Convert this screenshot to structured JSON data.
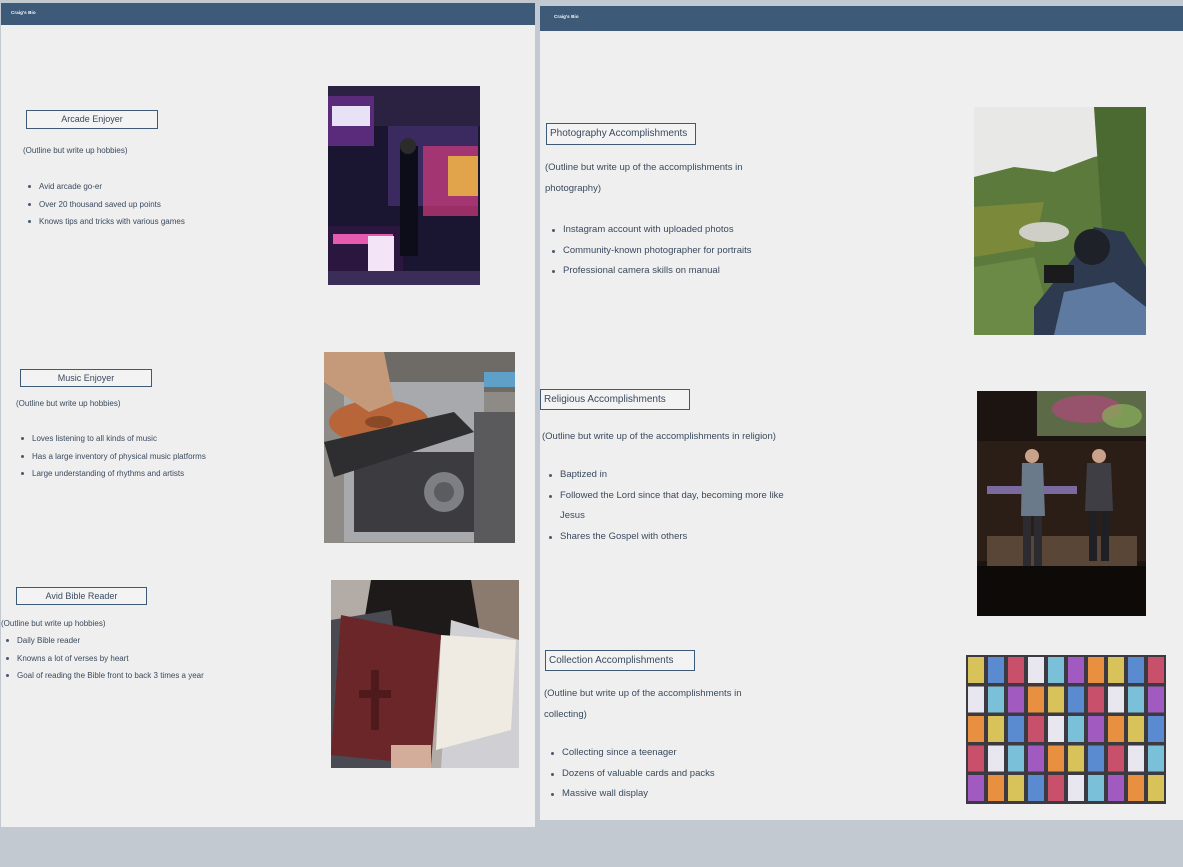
{
  "left": {
    "brand": "Craig's Bio",
    "hobbies": [
      {
        "title": "Arcade Enjoyer",
        "note": "(Outline but write up hobbies)",
        "items": [
          "Avid arcade go-er",
          "Over 20 thousand saved up points",
          "Knows tips and tricks with various games"
        ],
        "image": "arcade-photo"
      },
      {
        "title": "Music Enjoyer",
        "note": "(Outline but write up hobbies)",
        "items": [
          "Loves listening to all kinds of music",
          "Has a large inventory of physical music platforms",
          "Large understanding of rhythms and artists"
        ],
        "image": "cd-player-photo"
      },
      {
        "title": "Avid Bible Reader",
        "note": "(Outline but write up hobbies)",
        "items": [
          "Daily Bible reader",
          "Knowns a lot of verses by heart",
          "Goal of reading the Bible front to back 3 times a year"
        ],
        "image": "bible-reading-photo"
      }
    ]
  },
  "right": {
    "brand": "Craig's Bio",
    "sections": [
      {
        "title": "Photography Accomplishments",
        "note_lines": [
          "(Outline but write up of the accomplishments in",
          "photography)"
        ],
        "items": [
          [
            "Instagram account with uploaded photos"
          ],
          [
            "Community-known photographer for portraits"
          ],
          [
            "Professional camera skills on manual"
          ]
        ],
        "image": "garden-photographer-photo"
      },
      {
        "title": "Religious Accomplishments",
        "note_lines": [
          "(Outline but write up of the accomplishments in religion)"
        ],
        "items": [
          [
            "Baptized in"
          ],
          [
            "Followed the Lord since that day, becoming more like",
            "Jesus"
          ],
          [
            "Shares the Gospel with others"
          ]
        ],
        "image": "stage-speakers-photo"
      },
      {
        "title": "Collection Accomplishments",
        "note_lines": [
          "(Outline but write up of the accomplishments in",
          "collecting)"
        ],
        "items": [
          [
            "Collecting since a teenager"
          ],
          [
            "Dozens of valuable cards and packs"
          ],
          [
            "Massive wall display"
          ]
        ],
        "image": "card-packs-wall-photo"
      }
    ]
  }
}
